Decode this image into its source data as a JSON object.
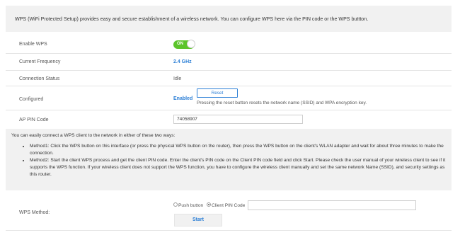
{
  "intro_text": "WPS (WiFi Protected Setup) provides easy and secure establishment of a wireless network. You can configure WPS here via the PIN code or the WPS buttton.",
  "enable_wps": {
    "label": "Enable WPS",
    "toggle_text": "ON",
    "state": "on"
  },
  "current_frequency": {
    "label": "Current Frequency",
    "value": "2.4 GHz"
  },
  "connection_status": {
    "label": "Connection Status",
    "value": "Idle"
  },
  "configured": {
    "label": "Configured",
    "value": "Enabled",
    "reset_button": "Reset",
    "reset_note": "Pressing the reset button resets the network name (SSID) and WPA encryption key."
  },
  "ap_pin": {
    "label": "AP PIN Code",
    "value": "74058907"
  },
  "info": {
    "heading": "You can easily connect a WPS client to the network in either of these two ways:",
    "methods": [
      "Method1: Click the WPS button on this interface (or press the physical WPS button on the router), then press the WPS button on the client's WLAN adapter and wait for about three minutes to make the connection.",
      "Method2: Start the client WPS process and get the client PIN code. Enter the client's PIN code on the Client PIN code field and click Start. Please check the user manual of your wireless client to see if it supports the WPS function. If your wireless client does not support the WPS function, you have to configure the wireless client manually and set the same network Name (SSID), and security settings as this router."
    ]
  },
  "wps_method": {
    "label": "WPS Method:",
    "options": [
      "Push button",
      "Client PIN Code"
    ],
    "selected": "Client PIN Code",
    "client_pin_value": "",
    "start_button": "Start"
  },
  "colors": {
    "accent": "#2c7fd6",
    "toggle_on": "#5cc42b",
    "panel_bg": "#f1f1f1"
  }
}
